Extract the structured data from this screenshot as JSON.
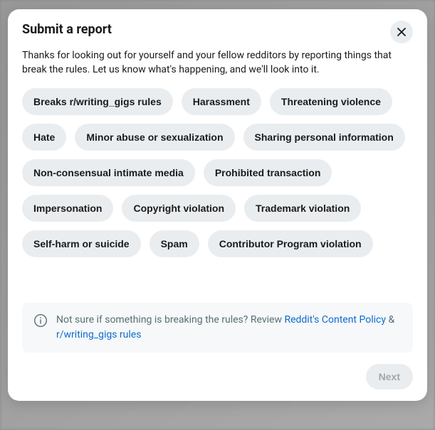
{
  "modal": {
    "title": "Submit a report",
    "description": "Thanks for looking out for yourself and your fellow redditors by reporting things that break the rules. Let us know what's happening, and we'll look into it."
  },
  "reasons": [
    "Breaks r/writing_gigs rules",
    "Harassment",
    "Threatening violence",
    "Hate",
    "Minor abuse or sexualization",
    "Sharing personal information",
    "Non-consensual intimate media",
    "Prohibited transaction",
    "Impersonation",
    "Copyright violation",
    "Trademark violation",
    "Self-harm or suicide",
    "Spam",
    "Contributor Program violation"
  ],
  "info": {
    "prefix": "Not sure if something is breaking the rules? Review ",
    "link1": "Reddit's Content Policy",
    "sep": " & ",
    "link2": "r/writing_gigs rules"
  },
  "footer": {
    "next": "Next"
  }
}
